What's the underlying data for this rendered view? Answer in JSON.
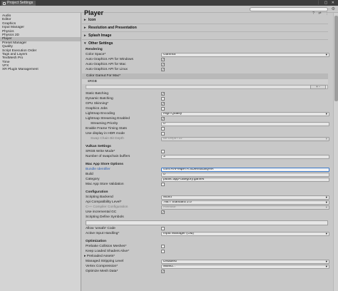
{
  "window": {
    "tab_title": "Project Settings"
  },
  "sidebar": {
    "items": [
      {
        "label": "Audio"
      },
      {
        "label": "Editor"
      },
      {
        "label": "Graphics"
      },
      {
        "label": "Input Manager"
      },
      {
        "label": "Physics"
      },
      {
        "label": "Physics 2D"
      },
      {
        "label": "Player",
        "selected": true
      },
      {
        "label": "Preset Manager"
      },
      {
        "label": "Quality"
      },
      {
        "label": "Script Execution Order"
      },
      {
        "label": "Tags and Layers"
      },
      {
        "label": "TextMesh Pro"
      },
      {
        "label": "Time"
      },
      {
        "label": "VFX"
      },
      {
        "label": "XR Plugin Management"
      }
    ]
  },
  "main": {
    "title": "Player",
    "sections": {
      "icon": "Icon",
      "resolution": "Resolution and Presentation",
      "splash": "Splash Image",
      "other": "Other Settings"
    },
    "rendering": {
      "header": "Rendering",
      "color_space_label": "Color Space*",
      "color_space_value": "Gamma",
      "auto_win": "Auto Graphics API  for Windows",
      "auto_mac": "Auto Graphics API  for Mac",
      "auto_linux": "Auto Graphics API  for Linux",
      "color_gamut_mac": "Color Gamut For Mac*",
      "srgb": "sRGB",
      "list_buttons": "+ -",
      "static_batching": "Static Batching",
      "dynamic_batching": "Dynamic Batching",
      "gpu_skinning": "GPU Skinning*",
      "graphics_jobs": "Graphics Jobs",
      "lightmap_encoding_label": "Lightmap Encoding",
      "lightmap_encoding_value": "High Quality",
      "lightmap_streaming": "Lightmap Streaming Enabled",
      "streaming_priority_label": "Streaming Priority",
      "streaming_priority_value": "0",
      "frame_timing": "Enable Frame Timing Stats",
      "hdr_display": "Use display in HDR mode",
      "swap_chain_label": "Swap Chain Bit Depth",
      "swap_chain_value": "Bit Depth 10"
    },
    "vulkan": {
      "header": "Vulkan Settings",
      "srgb_write": "SRGB Write Mode*",
      "swapchain_buffers_label": "Number of swapchain buffers",
      "swapchain_buffers_value": "3"
    },
    "mac_app_store": {
      "header": "Mac App Store Options",
      "bundle_id_label": "Bundle Identifier",
      "bundle_id_value": "com.RAFelipeTA.SDemoEasyAR",
      "build_label": "Build",
      "build_value": "0",
      "category_label": "Category",
      "category_value": "public.app-category.games",
      "receipt_validation": "Mac App Store Validation"
    },
    "configuration": {
      "header": "Configuration",
      "scripting_backend_label": "Scripting Backend",
      "scripting_backend_value": "Mono",
      "api_compat_label": "Api Compatibility Level*",
      "api_compat_value": ".NET Standard 2.0",
      "cpp_config_label": "C++ Compiler Configuration",
      "cpp_config_value": "Release",
      "incremental_gc": "Use incremental GC",
      "scripting_symbols": "Scripting Define Symbols",
      "allow_unsafe": "Allow 'unsafe' Code",
      "active_input_label": "Active Input Handling*",
      "active_input_value": "Input Manager (Old)"
    },
    "optimization": {
      "header": "Optimization",
      "prebake": "Prebake Collision Meshes*",
      "keep_shaders": "Keep Loaded Shaders Alive*",
      "preloaded_assets": "Preloaded Assets*",
      "stripping_label": "Managed Stripping Level",
      "stripping_value": "Disabled",
      "vertex_compression_label": "Vertex Compression*",
      "vertex_compression_value": "Mixed...",
      "optimize_mesh": "Optimize Mesh Data*"
    }
  }
}
